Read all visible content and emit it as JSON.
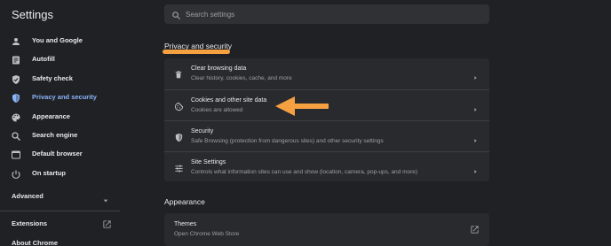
{
  "app": {
    "title": "Settings"
  },
  "search": {
    "placeholder": "Search settings",
    "value": ""
  },
  "sidebar": {
    "items": [
      {
        "label": "You and Google",
        "icon": "person-icon",
        "active": false
      },
      {
        "label": "Autofill",
        "icon": "autofill-icon",
        "active": false
      },
      {
        "label": "Safety check",
        "icon": "shield-check-icon",
        "active": false
      },
      {
        "label": "Privacy and security",
        "icon": "shield-icon",
        "active": true
      },
      {
        "label": "Appearance",
        "icon": "palette-icon",
        "active": false
      },
      {
        "label": "Search engine",
        "icon": "search-icon",
        "active": false
      },
      {
        "label": "Default browser",
        "icon": "browser-icon",
        "active": false
      },
      {
        "label": "On startup",
        "icon": "power-icon",
        "active": false
      }
    ],
    "advanced_label": "Advanced",
    "extensions_label": "Extensions",
    "about_label": "About Chrome"
  },
  "privacy": {
    "section_title": "Privacy and security",
    "rows": [
      {
        "title": "Clear browsing data",
        "subtitle": "Clear history, cookies, cache, and more",
        "icon": "trash-icon"
      },
      {
        "title": "Cookies and other site data",
        "subtitle": "Cookies are allowed",
        "icon": "cookie-icon"
      },
      {
        "title": "Security",
        "subtitle": "Safe Browsing (protection from dangerous sites) and other security settings",
        "icon": "shield-icon"
      },
      {
        "title": "Site Settings",
        "subtitle": "Controls what information sites can use and show (location, camera, pop-ups, and more)",
        "icon": "tune-icon"
      }
    ]
  },
  "appearance": {
    "section_title": "Appearance",
    "rows": [
      {
        "title": "Themes",
        "subtitle": "Open Chrome Web Store",
        "icon": "external-link-icon"
      }
    ]
  },
  "colors": {
    "background": "#202124",
    "card": "#292a2d",
    "accent": "#8ab4f8",
    "annotation": "#f5a142"
  }
}
